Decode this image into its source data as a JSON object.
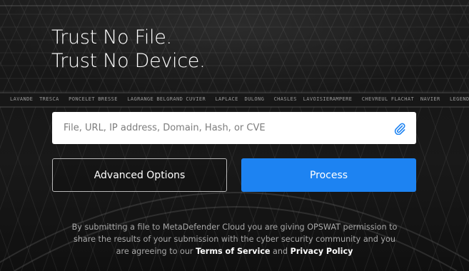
{
  "hero": {
    "line1": "Trust No File.",
    "line2": "Trust No Device."
  },
  "tower_names": [
    "LAVANDE",
    "TRESCA",
    "PONCELET",
    "BRESSE",
    "LAGRANGE",
    "BELGRAND",
    "CUVIER",
    "LAPLACE",
    "DULONG",
    "CHASLES",
    "LAVOISIER",
    "AMPERE",
    "CHEVREUL",
    "FLACHAT",
    "NAVIER",
    "LEGENDRE"
  ],
  "search": {
    "placeholder": "File, URL, IP address, Domain, Hash, or CVE",
    "value": "",
    "attach_icon": "paperclip-icon"
  },
  "buttons": {
    "advanced": "Advanced Options",
    "process": "Process"
  },
  "disclaimer": {
    "text_pre": "By submitting a file to MetaDefender Cloud you are giving OPSWAT permission to share the results of your submission with the cyber security community and you are agreeing to our ",
    "terms": "Terms of Service",
    "and": " and ",
    "privacy": "Privacy Policy"
  },
  "colors": {
    "accent": "#1d83f2",
    "background": "#1d1d1d",
    "outline_button_border": "#b9b9b9"
  }
}
